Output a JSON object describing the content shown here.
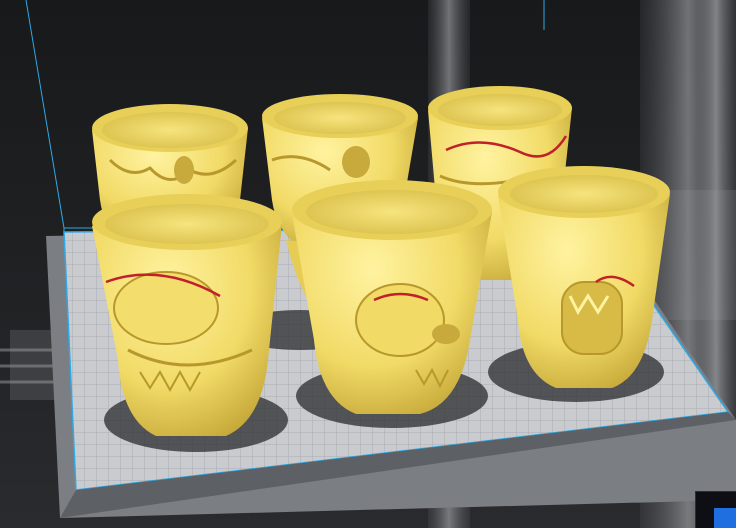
{
  "app": {
    "view": "3d-print-preview",
    "scene_type": "slicer-build-plate"
  },
  "scene": {
    "plate": {
      "surface_color": "#c7c9cc",
      "grid_color": "#a8adb3",
      "border_color": "#6b6f74",
      "bounds_color": "#2ea8e6"
    },
    "models": [
      {
        "name": "skull-cup-1",
        "color": "#f3de6a"
      },
      {
        "name": "skull-cup-2",
        "color": "#f3de6a"
      },
      {
        "name": "skull-cup-3",
        "color": "#f3de6a"
      },
      {
        "name": "skull-cup-4",
        "color": "#f3de6a"
      },
      {
        "name": "skull-cup-5",
        "color": "#f3de6a"
      },
      {
        "name": "skull-cup-6",
        "color": "#f3de6a"
      }
    ],
    "highlight_color": "#c0202a"
  },
  "ui": {
    "corner_button_color": "#1f6fe0"
  }
}
